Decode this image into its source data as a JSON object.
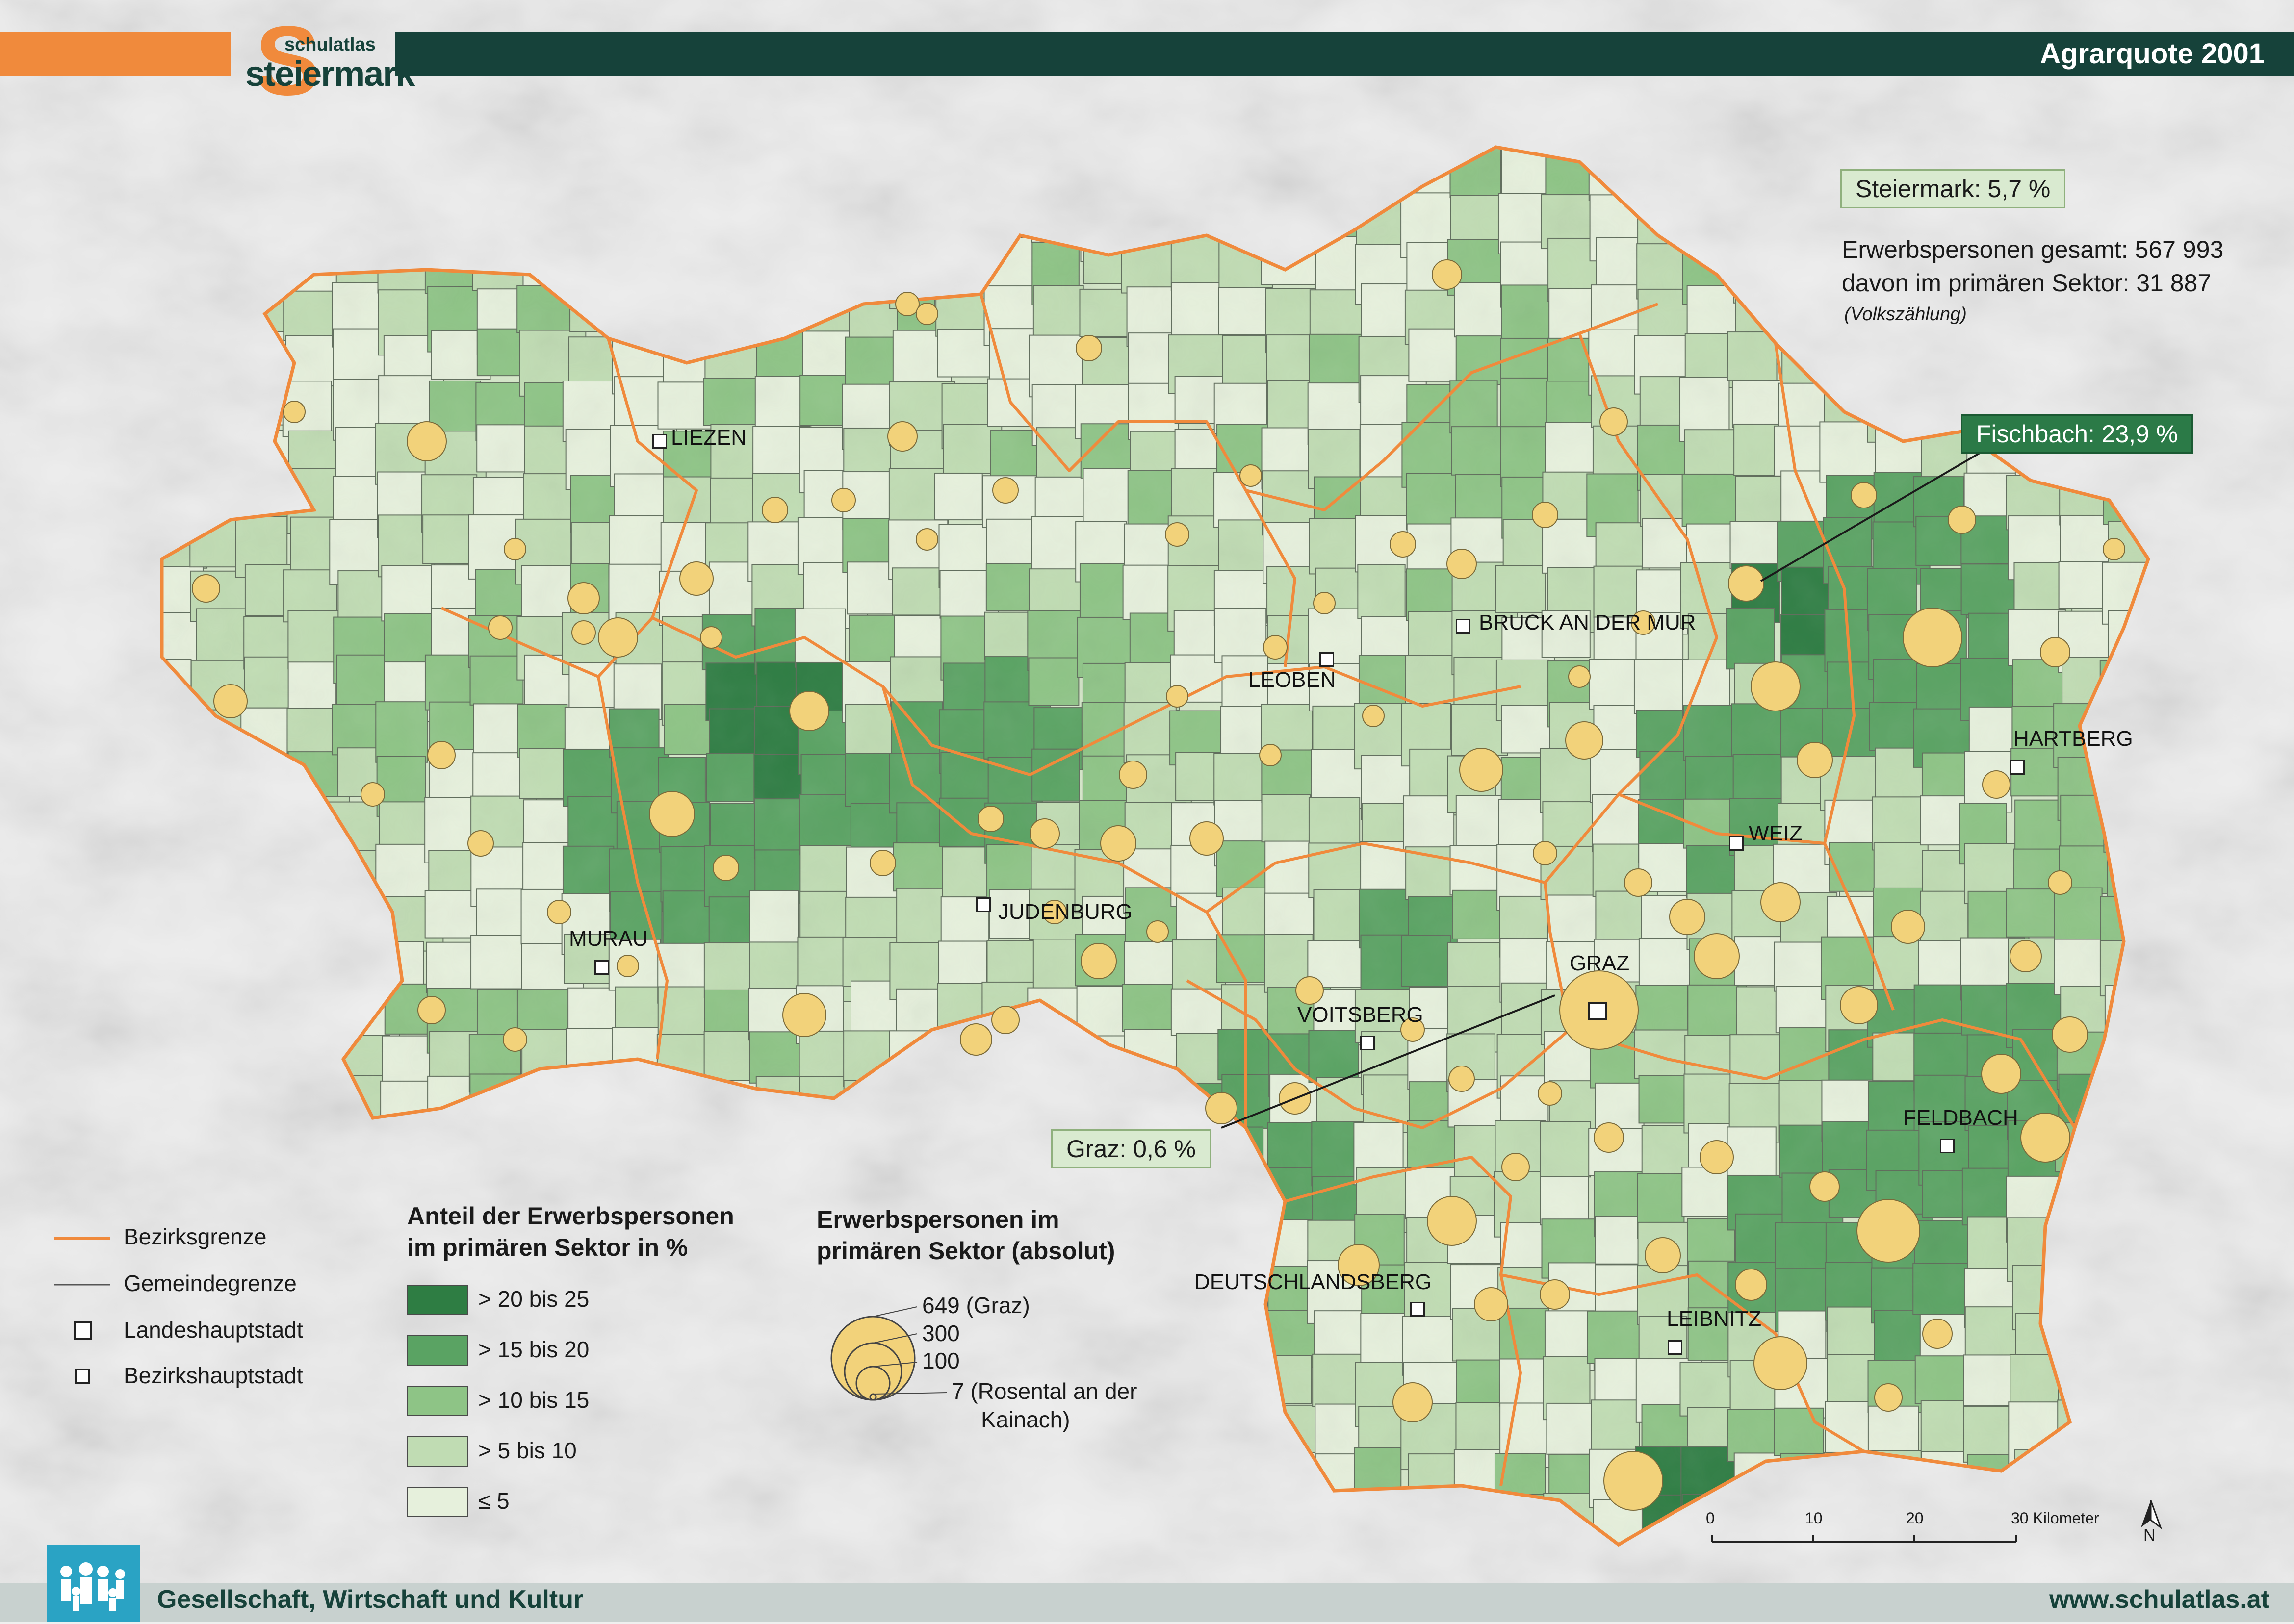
{
  "header": {
    "title": "Agrarquote 2001",
    "logo_small": "schulatlas",
    "logo_big": "steiermark",
    "logo_letter": "S"
  },
  "info": {
    "state_total": "Steiermark: 5,7 %",
    "employed_total": "Erwerbspersonen gesamt: 567 993",
    "primary_sector": "davon im primären Sektor: 31 887",
    "source": "(Volkszählung)",
    "fischbach": "Fischbach: 23,9 %",
    "graz": "Graz: 0,6 %"
  },
  "cities": [
    {
      "name": "LIEZEN",
      "type": "district"
    },
    {
      "name": "BRUCK AN DER MUR",
      "type": "district"
    },
    {
      "name": "LEOBEN",
      "type": "district"
    },
    {
      "name": "HARTBERG",
      "type": "district"
    },
    {
      "name": "WEIZ",
      "type": "district"
    },
    {
      "name": "MURAU",
      "type": "district"
    },
    {
      "name": "JUDENBURG",
      "type": "district"
    },
    {
      "name": "GRAZ",
      "type": "capital"
    },
    {
      "name": "VOITSBERG",
      "type": "district"
    },
    {
      "name": "FELDBACH",
      "type": "district"
    },
    {
      "name": "DEUTSCHLANDSBERG",
      "type": "district"
    },
    {
      "name": "LEIBNITZ",
      "type": "district"
    }
  ],
  "legend": {
    "lines": [
      {
        "label": "Bezirksgrenze"
      },
      {
        "label": "Gemeindegrenze"
      },
      {
        "label": "Landeshauptstadt"
      },
      {
        "label": "Bezirkshauptstadt"
      }
    ],
    "choropleth_title_1": "Anteil der Erwerbspersonen",
    "choropleth_title_2": "im primären Sektor in %",
    "classes": [
      {
        "label": "> 20 bis 25",
        "color": "#2e7d43"
      },
      {
        "label": "> 15 bis 20",
        "color": "#5aa363"
      },
      {
        "label": "> 10 bis 15",
        "color": "#8ec486"
      },
      {
        "label": "> 5 bis 10",
        "color": "#c0dcb3"
      },
      {
        "label": "≤ 5",
        "color": "#e6f0dc"
      }
    ],
    "bubble_title_1": "Erwerbspersonen im",
    "bubble_title_2": "primären Sektor (absolut)",
    "bubbles": [
      {
        "label": "649 (Graz)",
        "value": 649
      },
      {
        "label": "300",
        "value": 300
      },
      {
        "label": "100",
        "value": 100
      },
      {
        "label": "7 (Rosental an der",
        "value": 7
      },
      {
        "label": "Kainach)",
        "value": null
      }
    ]
  },
  "scale": {
    "ticks": [
      "0",
      "10",
      "20",
      "30 Kilometer"
    ],
    "north": "N"
  },
  "footer": {
    "left": "Gesellschaft, Wirtschaft und Kultur",
    "right": "www.schulatlas.at"
  },
  "colors": {
    "header_dark": "#16423a",
    "accent_orange": "#f08a3c",
    "bubble": "#f2d27a",
    "district_border": "#f08a3c"
  }
}
